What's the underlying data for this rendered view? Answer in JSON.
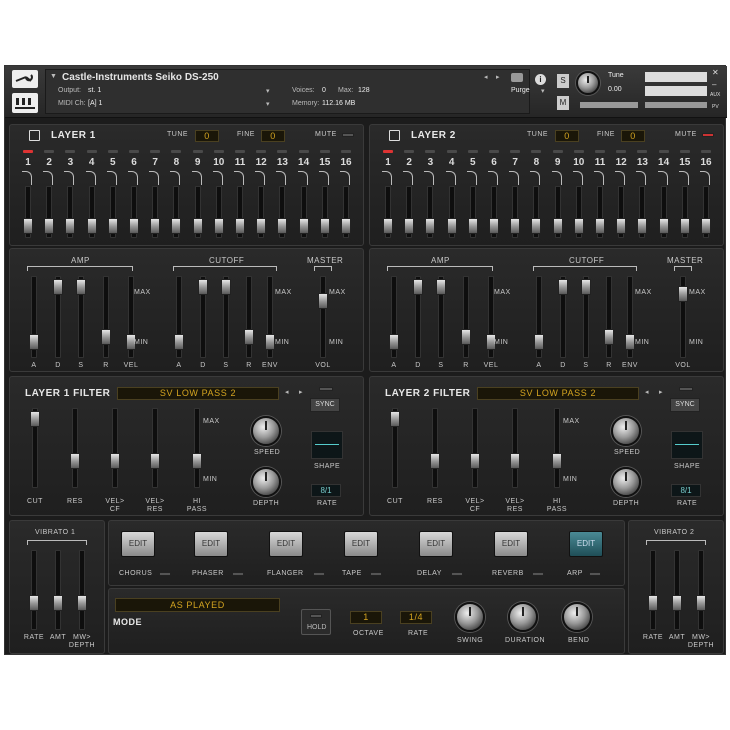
{
  "header": {
    "instrument_name": "Castle-Instruments Seiko DS-250",
    "output_label": "Output:",
    "output_value": "st. 1",
    "midi_label": "MIDI Ch:",
    "midi_value": "[A]  1",
    "voices_label": "Voices:",
    "voices_value": "0",
    "max_label": "Max:",
    "max_value": "128",
    "memory_label": "Memory:",
    "memory_value": "112.16 MB",
    "purge_label": "Purge",
    "tune_label": "Tune",
    "tune_value": "0.00",
    "s_label": "S",
    "m_label": "M",
    "aux_label": "AUX",
    "pv_label": "PV"
  },
  "layers": [
    {
      "title": "LAYER 1",
      "tune_label": "TUNE",
      "tune_value": "0",
      "fine_label": "FINE",
      "fine_value": "0",
      "mute_label": "MUTE",
      "mute_on": false,
      "steps": [
        "1",
        "2",
        "3",
        "4",
        "5",
        "6",
        "7",
        "8",
        "9",
        "10",
        "11",
        "12",
        "13",
        "14",
        "15",
        "16"
      ],
      "step_levels": [
        0.12,
        0.12,
        0.12,
        0.12,
        0.12,
        0.12,
        0.12,
        0.12,
        0.12,
        0.12,
        0.12,
        0.12,
        0.12,
        0.12,
        0.12,
        0.12
      ]
    },
    {
      "title": "LAYER 2",
      "tune_label": "TUNE",
      "tune_value": "0",
      "fine_label": "FINE",
      "fine_value": "0",
      "mute_label": "MUTE",
      "mute_on": true,
      "steps": [
        "1",
        "2",
        "3",
        "4",
        "5",
        "6",
        "7",
        "8",
        "9",
        "10",
        "11",
        "12",
        "13",
        "14",
        "15",
        "16"
      ],
      "step_levels": [
        0.12,
        0.12,
        0.12,
        0.12,
        0.12,
        0.12,
        0.12,
        0.12,
        0.12,
        0.12,
        0.12,
        0.12,
        0.12,
        0.12,
        0.12,
        0.12
      ]
    }
  ],
  "env": [
    {
      "amp_label": "AMP",
      "cutoff_label": "CUTOFF",
      "master_label": "MASTER",
      "max_label": "MAX",
      "min_label": "MIN",
      "amp_sliders": [
        "A",
        "D",
        "S",
        "R",
        "VEL"
      ],
      "amp_levels": [
        0.12,
        0.95,
        0.95,
        0.2,
        0.12
      ],
      "cutoff_sliders": [
        "A",
        "D",
        "S",
        "R",
        "ENV"
      ],
      "cutoff_levels": [
        0.12,
        0.95,
        0.95,
        0.2,
        0.12
      ],
      "vol_label": "VOL",
      "vol_level": 0.75
    },
    {
      "amp_label": "AMP",
      "cutoff_label": "CUTOFF",
      "master_label": "MASTER",
      "max_label": "MAX",
      "min_label": "MIN",
      "amp_sliders": [
        "A",
        "D",
        "S",
        "R",
        "VEL"
      ],
      "amp_levels": [
        0.12,
        0.95,
        0.95,
        0.2,
        0.12
      ],
      "cutoff_sliders": [
        "A",
        "D",
        "S",
        "R",
        "ENV"
      ],
      "cutoff_levels": [
        0.12,
        0.95,
        0.95,
        0.2,
        0.12
      ],
      "vol_label": "VOL",
      "vol_level": 0.85
    }
  ],
  "filters": [
    {
      "title": "LAYER 1 FILTER",
      "type": "SV LOW PASS 2",
      "sync_label": "SYNC",
      "speed_label": "SPEED",
      "depth_label": "DEPTH",
      "shape_label": "SHAPE",
      "rate_label": "RATE",
      "rate_value": "8/1",
      "max_label": "MAX",
      "min_label": "MIN",
      "sliders": [
        "CUT",
        "RES",
        "VEL>\nCF",
        "VEL>\nRES",
        "HI\nPASS"
      ],
      "levels": [
        0.95,
        0.3,
        0.3,
        0.3,
        0.3
      ]
    },
    {
      "title": "LAYER 2 FILTER",
      "type": "SV LOW PASS 2",
      "sync_label": "SYNC",
      "speed_label": "SPEED",
      "depth_label": "DEPTH",
      "shape_label": "SHAPE",
      "rate_label": "RATE",
      "rate_value": "8/1",
      "max_label": "MAX",
      "min_label": "MIN",
      "sliders": [
        "CUT",
        "RES",
        "VEL>\nCF",
        "VEL>\nRES",
        "HI\nPASS"
      ],
      "levels": [
        0.95,
        0.3,
        0.3,
        0.3,
        0.3
      ]
    }
  ],
  "vibrato": [
    {
      "title": "VIBRATO 1",
      "sliders": [
        "RATE",
        "AMT",
        "MW>\nDEPTH"
      ],
      "levels": [
        0.3,
        0.3,
        0.3
      ]
    },
    {
      "title": "VIBRATO 2",
      "sliders": [
        "RATE",
        "AMT",
        "MW>\nDEPTH"
      ],
      "levels": [
        0.3,
        0.3,
        0.3
      ]
    }
  ],
  "effects": {
    "edit_label": "EDIT",
    "items": [
      "CHORUS",
      "PHASER",
      "FLANGER",
      "TAPE",
      "DELAY",
      "REVERB",
      "ARP"
    ]
  },
  "arp": {
    "mode_value": "AS PLAYED",
    "mode_label": "MODE",
    "hold_label": "HOLD",
    "octave_value": "1",
    "octave_label": "OCTAVE",
    "rate_value": "1/4",
    "rate_label": "RATE",
    "swing_label": "SWING",
    "duration_label": "DURATION",
    "bend_label": "BEND"
  }
}
